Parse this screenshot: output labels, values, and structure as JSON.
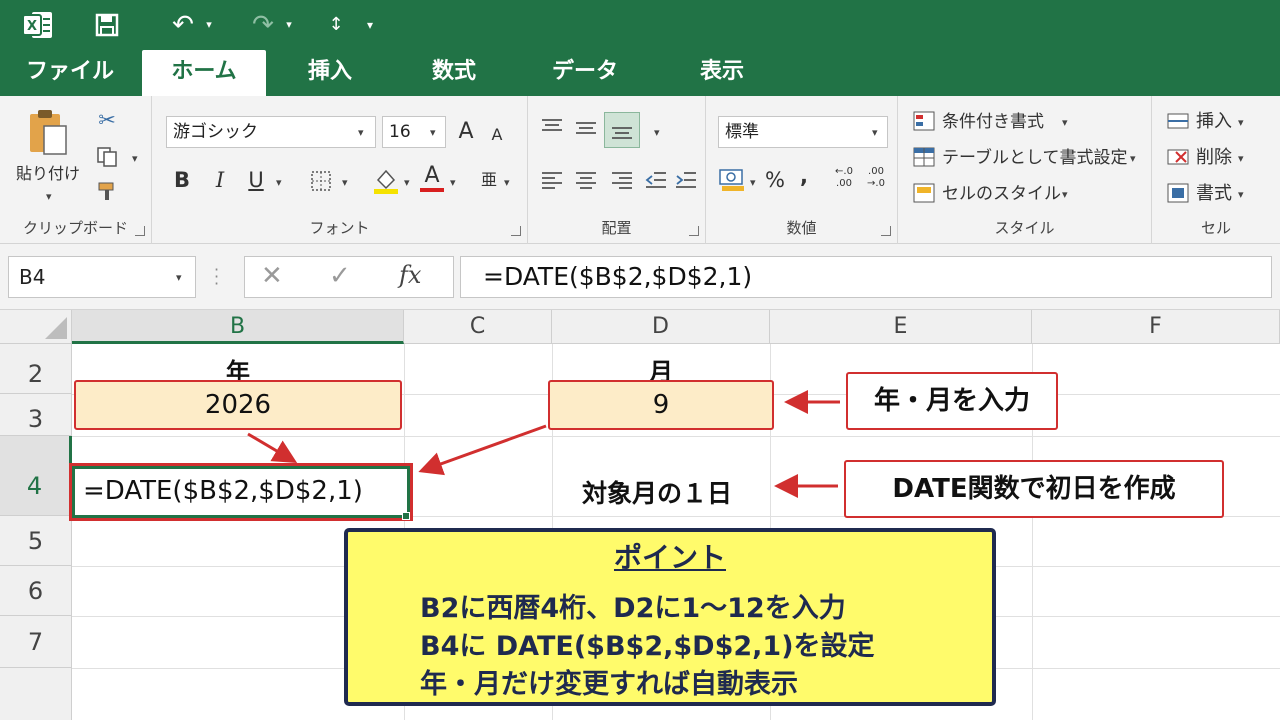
{
  "qat": {
    "undo": "↶",
    "redo": "↷",
    "touch": "↕",
    "more": "▾"
  },
  "tabs": [
    "ファイル",
    "ホーム",
    "挿入",
    "数式",
    "データ",
    "表示"
  ],
  "ribbon": {
    "clipboard": {
      "paste": "貼り付け",
      "label": "クリップボード"
    },
    "font": {
      "name": "游ゴシック",
      "size": "16",
      "bold": "B",
      "italic": "I",
      "underline": "U",
      "grow": "A",
      "shrink": "A",
      "label": "フォント"
    },
    "alignment": {
      "label": "配置"
    },
    "number": {
      "format": "標準",
      "percent": "%",
      "comma": ",",
      "label": "数値"
    },
    "styles": {
      "conditional": "条件付き書式",
      "table": "テーブルとして書式設定",
      "cell_styles": "セルのスタイル",
      "label": "スタイル"
    },
    "cells": {
      "insert": "挿入",
      "delete": "削除",
      "format": "書式",
      "label": "セル"
    }
  },
  "formula_bar": {
    "name_box": "B4",
    "fx": "fx",
    "formula": "=DATE($B$2,$D$2,1)"
  },
  "columns": [
    "B",
    "C",
    "D",
    "E",
    "F"
  ],
  "rows": [
    "2",
    "3",
    "4",
    "5",
    "6",
    "7"
  ],
  "cells": {
    "b2": "年",
    "b3": "2026",
    "d2": "月",
    "d3": "9",
    "b4": "=DATE($B$2,$D$2,1)",
    "d4": "対象月の１日"
  },
  "callouts": {
    "input": "年・月を入力",
    "date": "DATE関数で初日を作成"
  },
  "point": {
    "title": "ポイント",
    "lines": [
      "B2に西暦4桁、D2に1～12を入力",
      "B4に DATE($B$2,$D$2,1)を設定",
      "年・月だけ変更すれば自動表示"
    ]
  },
  "colors": {
    "excel_green": "#217346",
    "accent_red": "#d12f2f",
    "input_fill": "#fdecc8",
    "note_fill": "#fffb6b",
    "note_border": "#1f2a4f"
  }
}
